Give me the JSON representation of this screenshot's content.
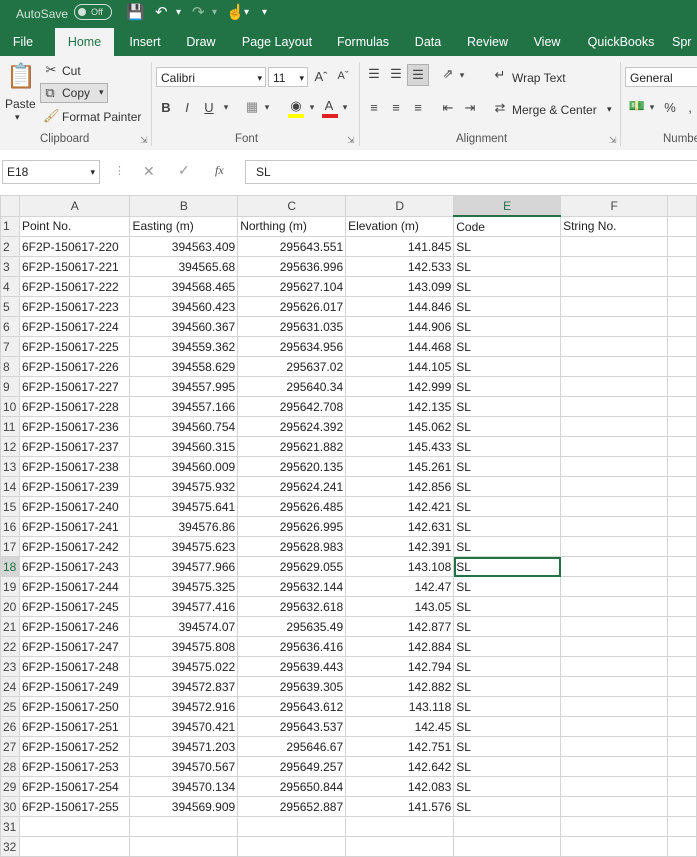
{
  "titlebar": {
    "autosave_label": "AutoSave",
    "toggle_state": "Off"
  },
  "tabs": [
    "File",
    "Home",
    "Insert",
    "Draw",
    "Page Layout",
    "Formulas",
    "Data",
    "Review",
    "View",
    "QuickBooks",
    "Spr"
  ],
  "active_tab": "Home",
  "clipboard": {
    "paste": "Paste",
    "cut": "Cut",
    "copy": "Copy",
    "format_painter": "Format Painter",
    "group": "Clipboard"
  },
  "font": {
    "name": "Calibri",
    "size": "11",
    "group": "Font"
  },
  "alignment": {
    "wrap_text": "Wrap Text",
    "merge_center": "Merge & Center",
    "group": "Alignment"
  },
  "number": {
    "format": "General",
    "group": "Numbe"
  },
  "formula_bar": {
    "cell_ref": "E18",
    "fx": "fx",
    "value": "SL"
  },
  "sheet": {
    "columns": [
      "A",
      "B",
      "C",
      "D",
      "E",
      "F"
    ],
    "selected_column": "E",
    "selected_row": "18",
    "header": [
      "Point No.",
      "Easting (m)",
      "Northing (m)",
      "Elevation (m)",
      "Code",
      "String No."
    ],
    "rows": [
      [
        "6F2P-150617-220",
        "394563.409",
        "295643.551",
        "141.845",
        "SL"
      ],
      [
        "6F2P-150617-221",
        "394565.68",
        "295636.996",
        "142.533",
        "SL"
      ],
      [
        "6F2P-150617-222",
        "394568.465",
        "295627.104",
        "143.099",
        "SL"
      ],
      [
        "6F2P-150617-223",
        "394560.423",
        "295626.017",
        "144.846",
        "SL"
      ],
      [
        "6F2P-150617-224",
        "394560.367",
        "295631.035",
        "144.906",
        "SL"
      ],
      [
        "6F2P-150617-225",
        "394559.362",
        "295634.956",
        "144.468",
        "SL"
      ],
      [
        "6F2P-150617-226",
        "394558.629",
        "295637.02",
        "144.105",
        "SL"
      ],
      [
        "6F2P-150617-227",
        "394557.995",
        "295640.34",
        "142.999",
        "SL"
      ],
      [
        "6F2P-150617-228",
        "394557.166",
        "295642.708",
        "142.135",
        "SL"
      ],
      [
        "6F2P-150617-236",
        "394560.754",
        "295624.392",
        "145.062",
        "SL"
      ],
      [
        "6F2P-150617-237",
        "394560.315",
        "295621.882",
        "145.433",
        "SL"
      ],
      [
        "6F2P-150617-238",
        "394560.009",
        "295620.135",
        "145.261",
        "SL"
      ],
      [
        "6F2P-150617-239",
        "394575.932",
        "295624.241",
        "142.856",
        "SL"
      ],
      [
        "6F2P-150617-240",
        "394575.641",
        "295626.485",
        "142.421",
        "SL"
      ],
      [
        "6F2P-150617-241",
        "394576.86",
        "295626.995",
        "142.631",
        "SL"
      ],
      [
        "6F2P-150617-242",
        "394575.623",
        "295628.983",
        "142.391",
        "SL"
      ],
      [
        "6F2P-150617-243",
        "394577.966",
        "295629.055",
        "143.108",
        "SL"
      ],
      [
        "6F2P-150617-244",
        "394575.325",
        "295632.144",
        "142.47",
        "SL"
      ],
      [
        "6F2P-150617-245",
        "394577.416",
        "295632.618",
        "143.05",
        "SL"
      ],
      [
        "6F2P-150617-246",
        "394574.07",
        "295635.49",
        "142.877",
        "SL"
      ],
      [
        "6F2P-150617-247",
        "394575.808",
        "295636.416",
        "142.884",
        "SL"
      ],
      [
        "6F2P-150617-248",
        "394575.022",
        "295639.443",
        "142.794",
        "SL"
      ],
      [
        "6F2P-150617-249",
        "394572.837",
        "295639.305",
        "142.882",
        "SL"
      ],
      [
        "6F2P-150617-250",
        "394572.916",
        "295643.612",
        "143.118",
        "SL"
      ],
      [
        "6F2P-150617-251",
        "394570.421",
        "295643.537",
        "142.45",
        "SL"
      ],
      [
        "6F2P-150617-252",
        "394571.203",
        "295646.67",
        "142.751",
        "SL"
      ],
      [
        "6F2P-150617-253",
        "394570.567",
        "295649.257",
        "142.642",
        "SL"
      ],
      [
        "6F2P-150617-254",
        "394570.134",
        "295650.844",
        "142.083",
        "SL"
      ],
      [
        "6F2P-150617-255",
        "394569.909",
        "295652.887",
        "141.576",
        "SL"
      ]
    ],
    "row_numbers": [
      "1",
      "2",
      "3",
      "4",
      "5",
      "6",
      "7",
      "8",
      "9",
      "10",
      "11",
      "12",
      "13",
      "14",
      "15",
      "16",
      "17",
      "18",
      "19",
      "20",
      "21",
      "22",
      "23",
      "24",
      "25",
      "26",
      "27",
      "28",
      "29",
      "30",
      "31",
      "32"
    ]
  },
  "colors": {
    "brand": "#217346",
    "selection": "#217346"
  }
}
